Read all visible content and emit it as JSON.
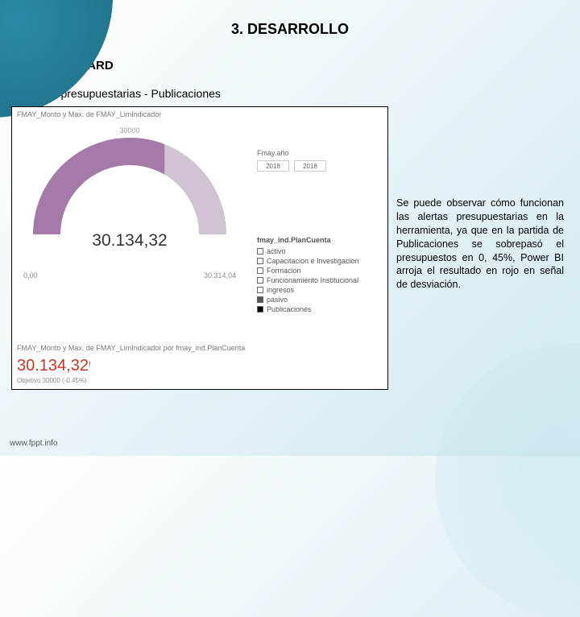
{
  "page": {
    "title": "3. DESARROLLO",
    "section": "3.4. DASHBOARD",
    "subtitle": "Alertas presupuestarias - Publicaciones"
  },
  "gauge": {
    "header": "FMAY_Monto y Max. de FMAY_LimIndicador",
    "max": "30000",
    "value": "30.134,32",
    "left_label": "0,00",
    "right_label": "30.314,04"
  },
  "filter": {
    "label": "Fmay.año",
    "from": "2018",
    "to": "2018"
  },
  "legend": {
    "title": "fmay_ind.PlanCuenta",
    "items": [
      {
        "label": "activo",
        "fill": "none"
      },
      {
        "label": "Capacitacion e Investigacion",
        "fill": "none"
      },
      {
        "label": "Formacion",
        "fill": "none"
      },
      {
        "label": "Funcionamiento Institucional",
        "fill": "none"
      },
      {
        "label": "ingresos",
        "fill": "none"
      },
      {
        "label": "pasivo",
        "fill": "dark"
      },
      {
        "label": "Publicaciones",
        "fill": "black"
      }
    ]
  },
  "kpi": {
    "header": "FMAY_Monto y Max. de FMAY_LimIndicador por fmay_ind.PlanCuenta",
    "value": "30.134,32",
    "indicator": "!",
    "sub": "Objetivo 30000 (-0.45%)"
  },
  "description": "Se puede observar cómo funcionan las alertas presupuestarias en la herramienta, ya que en la partida de Publicaciones se sobrepasó el presupuestos en 0, 45%, Power BI arroja el resultado en rojo en señal de desviación.",
  "footer": {
    "url": "www.fppt.info"
  },
  "chart_data": {
    "type": "gauge",
    "title": "FMAY_Monto y Max. de FMAY_LimIndicador",
    "value": 30134.32,
    "min": 0,
    "max": 30000,
    "range_displayed": [
      0,
      30314.04
    ],
    "target": 30000,
    "deviation_pct": -0.45,
    "selected_category": "Publicaciones",
    "year_range": [
      2018,
      2018
    ]
  }
}
